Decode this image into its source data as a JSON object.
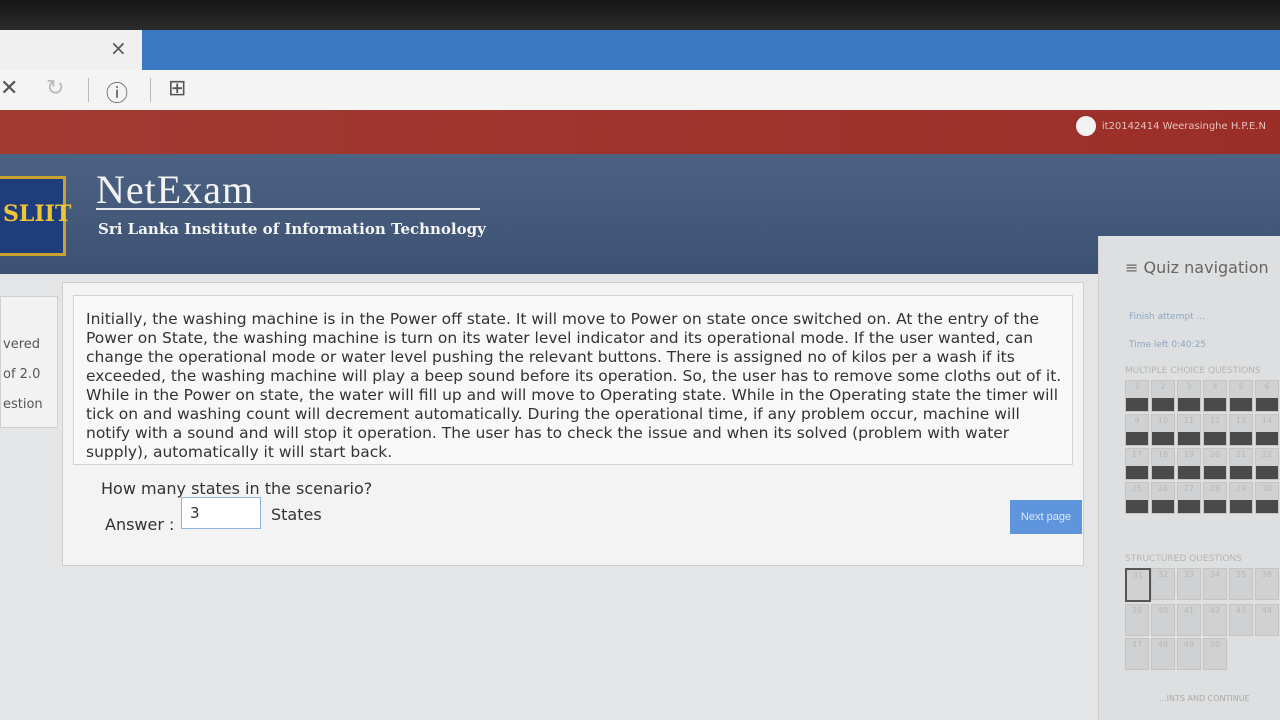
{
  "browser": {
    "close_tab_glyph": "×",
    "stop_glyph": "✕",
    "reload_glyph": "↻",
    "info_glyph": "ⓘ",
    "page_glyph": "⊞"
  },
  "header": {
    "user_name": "it20142414 Weerasinghe H.P.E.N",
    "app_title": "NetExam",
    "institute": "Sri Lanka Institute of Information Technology",
    "logo_text": "SLIIT"
  },
  "left_info": {
    "line1": "vered",
    "line2": "of 2.0",
    "line3": "estion"
  },
  "question": {
    "scenario": "Initially, the washing machine is in the Power off state. It will move to Power on state once switched on. At the entry of the Power on State, the washing machine is turn on its water level indicator and its operational mode. If the user wanted, can change the operational mode or water level pushing the relevant buttons. There is assigned no of kilos per a wash if its exceeded, the washing machine will play a beep sound before its operation. So, the user has to remove some cloths out of it. While in the Power on state, the water will fill up and will move to Operating state. While in the Operating state the timer will tick on and washing count will decrement automatically. During the operational time, if any problem occur, machine will notify with a sound and will stop it operation. The user has to check the issue and when its solved (problem with water supply), automatically it will start back.",
    "prompt": "How many states in the scenario?",
    "answer_label": "Answer :",
    "answer_value": "3",
    "units": "States",
    "next_button": "Next page"
  },
  "quiz_nav": {
    "title": "≡ Quiz navigation",
    "finish_attempt": "Finish attempt ...",
    "time_left": "Time left 0:40:25",
    "mcq_label": "MULTIPLE CHOICE QUESTIONS",
    "mcq_numbers": [
      "1",
      "2",
      "3",
      "4",
      "5",
      "6",
      "7",
      "9",
      "10",
      "11",
      "12",
      "13",
      "14",
      "15",
      "17",
      "18",
      "19",
      "20",
      "21",
      "22",
      "23",
      "25",
      "26",
      "27",
      "28",
      "29",
      "30",
      "31"
    ],
    "structured_label": "STRUCTURED QUESTIONS",
    "structured_numbers": [
      "31",
      "32",
      "33",
      "34",
      "35",
      "36",
      "37",
      "39",
      "40",
      "41",
      "42",
      "43",
      "44",
      "45",
      "47",
      "48",
      "49",
      "50"
    ],
    "bottom_label": "...INTS AND CONTINUE"
  }
}
